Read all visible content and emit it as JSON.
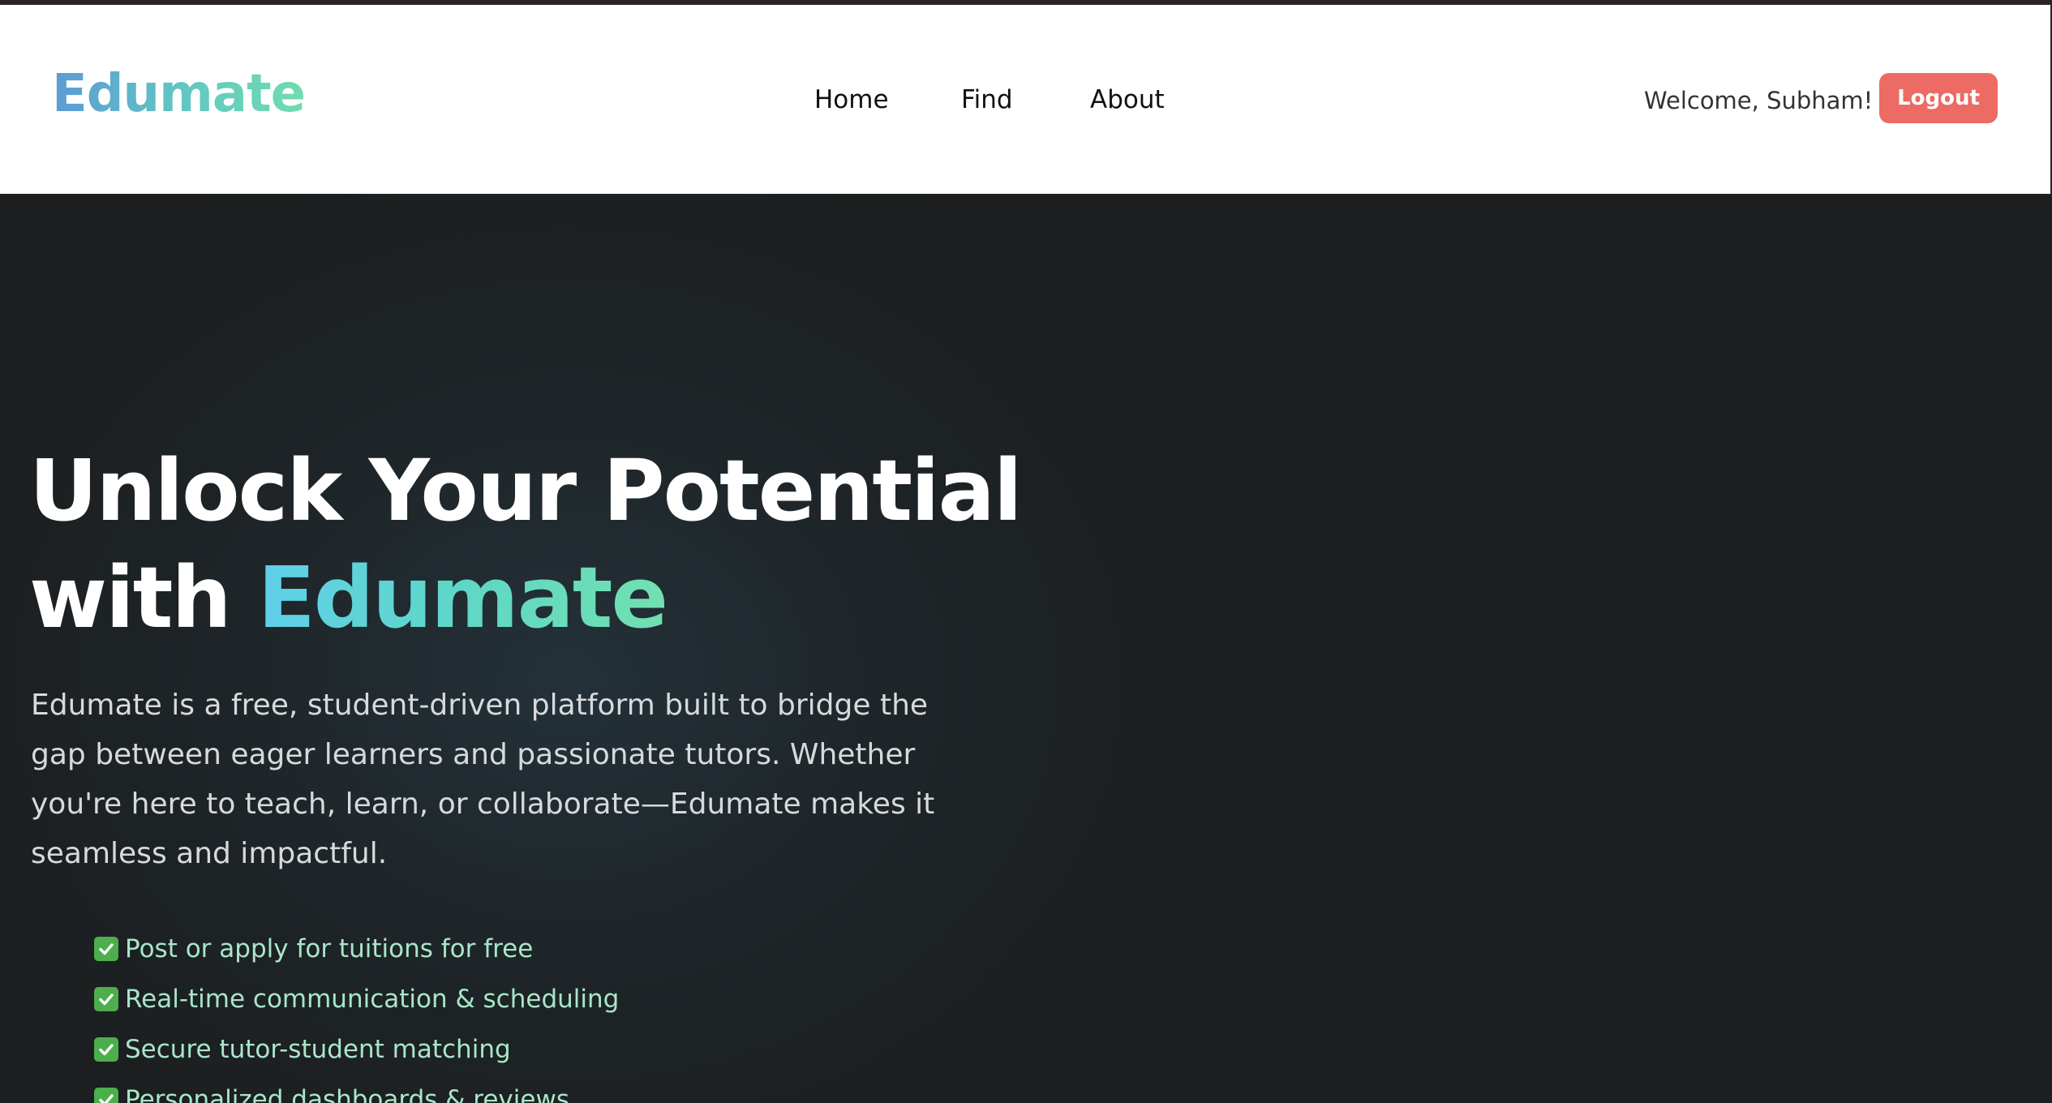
{
  "header": {
    "logo": "Edumate",
    "nav": [
      {
        "label": "Home"
      },
      {
        "label": "Find"
      },
      {
        "label": "About"
      }
    ],
    "welcome_text": "Welcome, Subham!",
    "logout_label": "Logout"
  },
  "hero": {
    "title_line1": "Unlock Your Potential",
    "title_line2_prefix": "with ",
    "title_accent": "Edumate",
    "description": "Edumate is a free, student-driven platform built to bridge the gap between eager learners and passionate tutors. Whether you're here to teach, learn, or collaborate—Edumate makes it seamless and impactful.",
    "features": [
      {
        "icon": "check-icon",
        "text": "Post or apply for tuitions for free"
      },
      {
        "icon": "check-icon",
        "text": "Real-time communication & scheduling"
      },
      {
        "icon": "check-icon",
        "text": "Secure tutor-student matching"
      },
      {
        "icon": "check-icon",
        "text": "Personalized dashboards & reviews"
      }
    ]
  },
  "colors": {
    "logout_bg": "#ec6b64",
    "hero_bg": "#1c1e1f",
    "feature_text": "#a8e6c8",
    "check_bg": "#4cae4c"
  }
}
